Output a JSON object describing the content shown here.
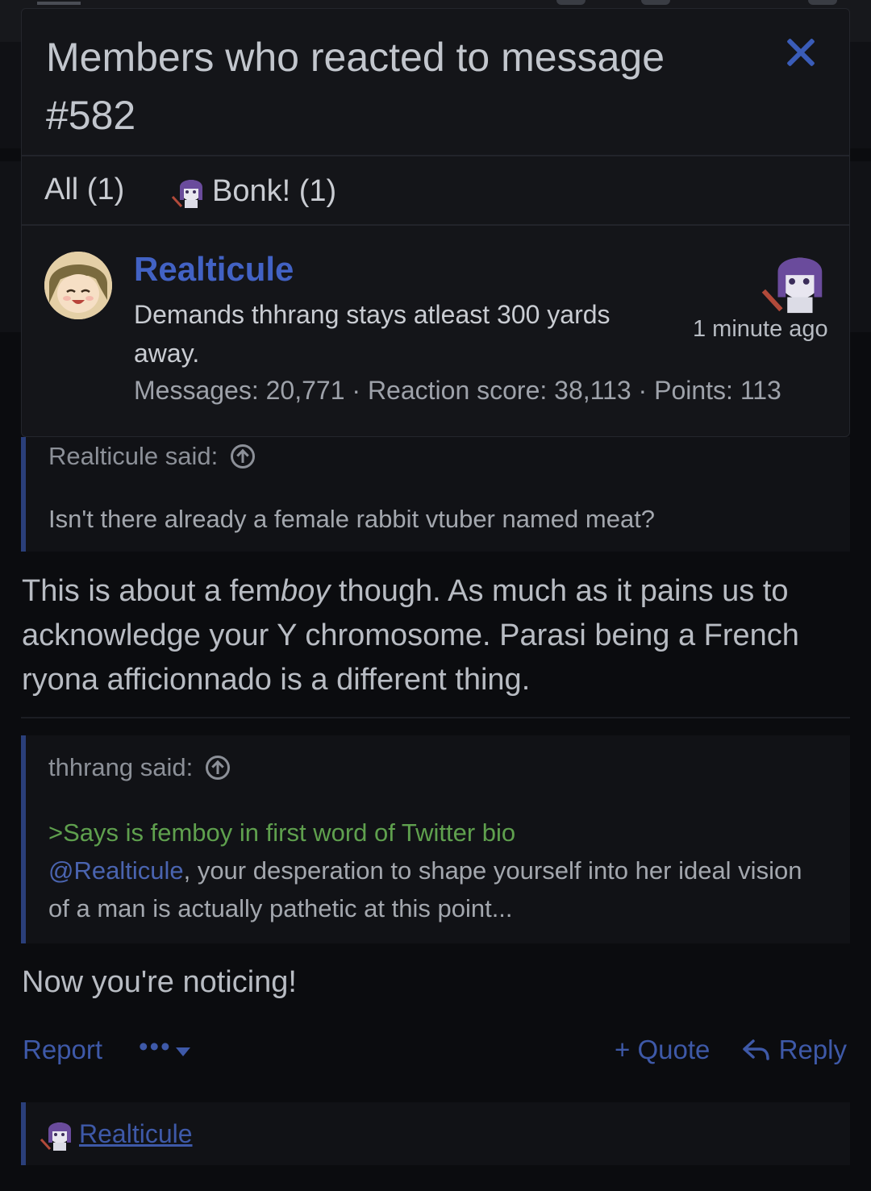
{
  "overlay": {
    "title": "Members who reacted to message #582",
    "tabs": [
      {
        "label": "All (1)"
      },
      {
        "label": "Bonk! (1)",
        "icon": "bonk-reaction-icon"
      }
    ],
    "member": {
      "name": "Realticule",
      "title": "Demands thhrang stays atleast 300 yards away.",
      "stats": "Messages: 20,771 · Reaction score: 38,113 · Points: 113",
      "time": "1 minute ago",
      "reaction_icon": "bonk-reaction-icon"
    }
  },
  "quote1": {
    "author": "Realticule said:",
    "body": "Isn't there already a female rabbit vtuber named meat?"
  },
  "post1": {
    "before": "This is about a fem",
    "italic": "boy",
    "after": " though. As much as it pains us to acknowledge your Y chromosome. Parasi being a French ryona afficionnado is a different thing."
  },
  "quote2": {
    "author": "thhrang said:",
    "greentext": ">Says is femboy in first word of Twitter bio",
    "mention": "@Realticule",
    "body": ", your desperation to shape yourself into her ideal vision of a man is actually pathetic at this point..."
  },
  "post2": {
    "text": "Now you're noticing!"
  },
  "actions": {
    "report": "Report",
    "more": "•••",
    "quote": "+ Quote",
    "reply": "Reply"
  },
  "reactions_bar": {
    "user": "Realticule",
    "icon": "bonk-reaction-icon"
  },
  "colors": {
    "accent": "#3e59a8",
    "name": "#4262c4",
    "greentext": "#5fa04e",
    "background": "#0b0c0f"
  }
}
